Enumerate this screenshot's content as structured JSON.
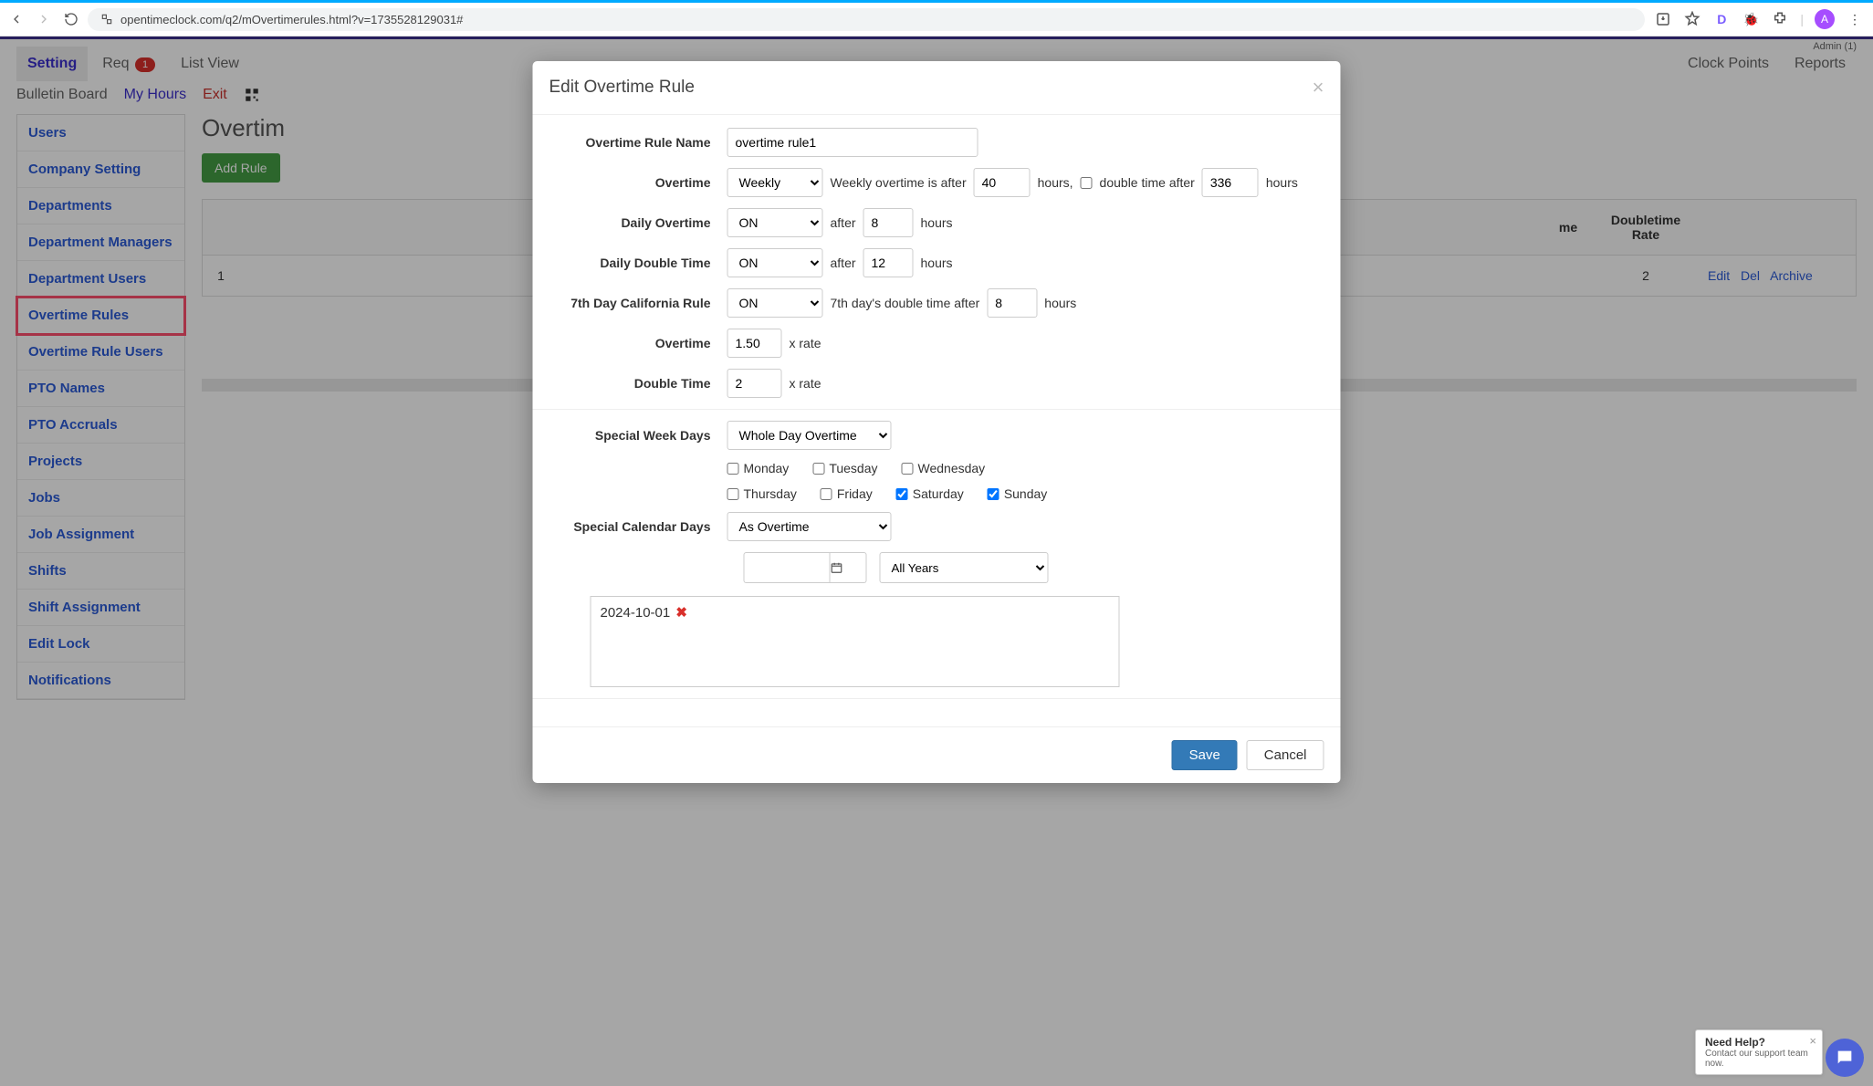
{
  "browser": {
    "url": "opentimeclock.com/q2/mOvertimerules.html?v=1735528129031#",
    "avatar_initial": "A"
  },
  "header": {
    "admin_label": "Admin (1)",
    "tabs": {
      "setting": "Setting",
      "req": "Req",
      "req_badge": "1",
      "list_view": "List View",
      "clock_points": "Clock Points",
      "reports": "Reports"
    },
    "second": {
      "bulletin": "Bulletin Board",
      "my_hours": "My Hours",
      "exit": "Exit"
    }
  },
  "sidebar": {
    "items": [
      "Users",
      "Company Setting",
      "Departments",
      "Department Managers",
      "Department Users",
      "Overtime Rules",
      "Overtime Rule Users",
      "PTO Names",
      "PTO Accruals",
      "Projects",
      "Jobs",
      "Job Assignment",
      "Shifts",
      "Shift Assignment",
      "Edit Lock",
      "Notifications"
    ],
    "highlighted_index": 5
  },
  "content": {
    "title": "Overtim",
    "add_btn": "Add Rule",
    "table": {
      "headers": {
        "dt_rate": "Doubletime Rate",
        "partial_header": "me"
      },
      "row": {
        "idx": "1",
        "dt_rate": "2",
        "actions": {
          "edit": "Edit",
          "del": "Del",
          "archive": "Archive"
        }
      }
    }
  },
  "modal": {
    "title": "Edit Overtime Rule",
    "fields": {
      "name_label": "Overtime Rule Name",
      "name_value": "overtime rule1",
      "overtime_label": "Overtime",
      "overtime_select": "Weekly",
      "weekly_text_1": "Weekly overtime is after",
      "weekly_after_value": "40",
      "weekly_text_2": "hours,",
      "double_time_after_label": "double time after",
      "double_time_after_value": "336",
      "weekly_text_3": "hours",
      "daily_ot_label": "Daily Overtime",
      "daily_ot_select": "ON",
      "daily_ot_after_label": "after",
      "daily_ot_hours": "8",
      "daily_ot_hours_label": "hours",
      "daily_dt_label": "Daily Double Time",
      "daily_dt_select": "ON",
      "daily_dt_after_label": "after",
      "daily_dt_hours": "12",
      "daily_dt_hours_label": "hours",
      "ca_label": "7th Day California Rule",
      "ca_select": "ON",
      "ca_text": "7th day's double time after",
      "ca_hours": "8",
      "ca_hours_label": "hours",
      "ot_rate_label": "Overtime",
      "ot_rate_value": "1.50",
      "ot_rate_suffix": "x rate",
      "dt_rate_label": "Double Time",
      "dt_rate_value": "2",
      "dt_rate_suffix": "x rate",
      "special_week_label": "Special Week Days",
      "special_week_select": "Whole Day Overtime",
      "days": {
        "mon": "Monday",
        "tue": "Tuesday",
        "wed": "Wednesday",
        "thu": "Thursday",
        "fri": "Friday",
        "sat": "Saturday",
        "sun": "Sunday",
        "sat_checked": true,
        "sun_checked": true
      },
      "special_cal_label": "Special Calendar Days",
      "special_cal_select": "As Overtime",
      "year_select": "All Years",
      "special_date": "2024-10-01"
    },
    "buttons": {
      "save": "Save",
      "cancel": "Cancel"
    }
  },
  "help": {
    "title": "Need Help?",
    "sub": "Contact our support team now."
  }
}
